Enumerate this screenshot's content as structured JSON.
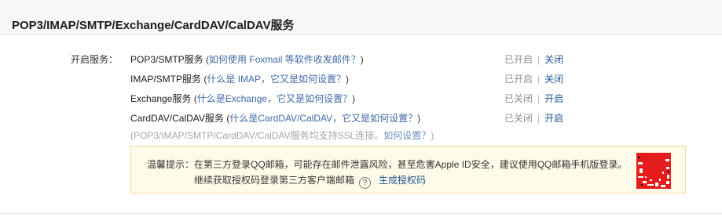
{
  "header": {
    "title": "POP3/IMAP/SMTP/Exchange/CardDAV/CalDAV服务"
  },
  "services_label": "开启服务：",
  "services": [
    {
      "name": "POP3/SMTP服务",
      "help": "如何使用 Foxmail 等软件收发邮件？",
      "status": "已开启",
      "action": "关闭"
    },
    {
      "name": "IMAP/SMTP服务",
      "help": "什么是 IMAP，它又是如何设置？",
      "status": "已开启",
      "action": "关闭"
    },
    {
      "name": "Exchange服务",
      "help": "什么是Exchange，它又是如何设置？",
      "status": "已关闭",
      "action": "开启"
    },
    {
      "name": "CardDAV/CalDAV服务",
      "help": "什么是CardDAV/CalDAV，它又是如何设置？",
      "status": "已关闭",
      "action": "开启"
    }
  ],
  "ssl_note": {
    "text": "(POP3/IMAP/SMTP/CardDAV/CalDAV服务均支持SSL连接。",
    "link": "如何设置？",
    "close": ")"
  },
  "tip": {
    "label": "温馨提示：",
    "text": "在第三方登录QQ邮箱，可能存在邮件泄露风险，甚至危害Apple ID安全，建议使用QQ邮箱手机版登录。",
    "line2": "继续获取授权码登录第三方客户端邮箱",
    "help_symbol": "?",
    "generate_link": "生成授权码"
  },
  "colors": {
    "link": "#3f6aa7",
    "action": "#1e5494",
    "tip_bg": "#fffbe9",
    "tip_border": "#f1dda4",
    "qr_bg": "#e61c1c"
  }
}
